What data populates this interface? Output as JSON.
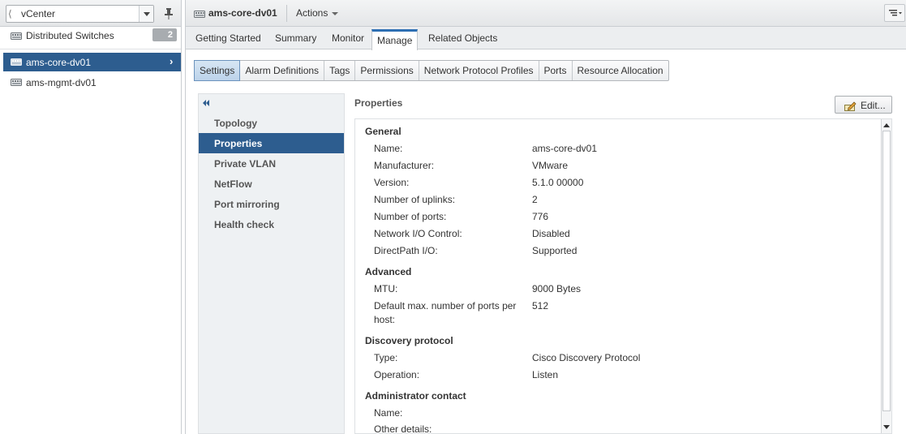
{
  "nav": {
    "breadcrumb": "vCenter",
    "category": {
      "label": "Distributed Switches",
      "count": "2"
    },
    "objects": [
      {
        "label": "ams-core-dv01",
        "selected": true
      },
      {
        "label": "ams-mgmt-dv01",
        "selected": false
      }
    ]
  },
  "header": {
    "title": "ams-core-dv01",
    "actions_label": "Actions"
  },
  "tabs": [
    {
      "label": "Getting Started",
      "active": false
    },
    {
      "label": "Summary",
      "active": false
    },
    {
      "label": "Monitor",
      "active": false
    },
    {
      "label": "Manage",
      "active": true
    },
    {
      "label": "Related Objects",
      "active": false
    }
  ],
  "subtabs": [
    {
      "label": "Settings",
      "active": true
    },
    {
      "label": "Alarm Definitions",
      "active": false
    },
    {
      "label": "Tags",
      "active": false
    },
    {
      "label": "Permissions",
      "active": false
    },
    {
      "label": "Network Protocol Profiles",
      "active": false
    },
    {
      "label": "Ports",
      "active": false
    },
    {
      "label": "Resource Allocation",
      "active": false
    }
  ],
  "settings_list": [
    {
      "label": "Topology",
      "active": false
    },
    {
      "label": "Properties",
      "active": true
    },
    {
      "label": "Private VLAN",
      "active": false
    },
    {
      "label": "NetFlow",
      "active": false
    },
    {
      "label": "Port mirroring",
      "active": false
    },
    {
      "label": "Health check",
      "active": false
    }
  ],
  "properties": {
    "title": "Properties",
    "edit_label": "Edit...",
    "sections": [
      {
        "heading": "General",
        "rows": [
          {
            "label": "Name:",
            "value": "ams-core-dv01"
          },
          {
            "label": "Manufacturer:",
            "value": "VMware"
          },
          {
            "label": "Version:",
            "value": "5.1.0 00000"
          },
          {
            "label": "Number of uplinks:",
            "value": "2"
          },
          {
            "label": "Number of ports:",
            "value": "776"
          },
          {
            "label": "Network I/O Control:",
            "value": "Disabled"
          },
          {
            "label": "DirectPath I/O:",
            "value": "Supported"
          }
        ]
      },
      {
        "heading": "Advanced",
        "rows": [
          {
            "label": "MTU:",
            "value": "9000 Bytes"
          },
          {
            "label": "Default max. number of ports per host:",
            "value": "512"
          }
        ]
      },
      {
        "heading": "Discovery protocol",
        "rows": [
          {
            "label": "Type:",
            "value": "Cisco Discovery Protocol"
          },
          {
            "label": "Operation:",
            "value": "Listen"
          }
        ]
      },
      {
        "heading": "Administrator contact",
        "rows": [
          {
            "label": "Name:",
            "value": ""
          },
          {
            "label": "Other details:",
            "value": ""
          }
        ]
      }
    ]
  },
  "colors": {
    "selection": "#2d5d8f",
    "active_tab_accent": "#2d6fb3",
    "subtab_active": "#bcd3ea"
  },
  "icons": {
    "switch": "distributed-switch-icon",
    "pin": "pin-icon",
    "edit": "edit-pencil-icon",
    "collapse": "collapse-double-chevron-icon",
    "menu": "list-menu-icon"
  }
}
